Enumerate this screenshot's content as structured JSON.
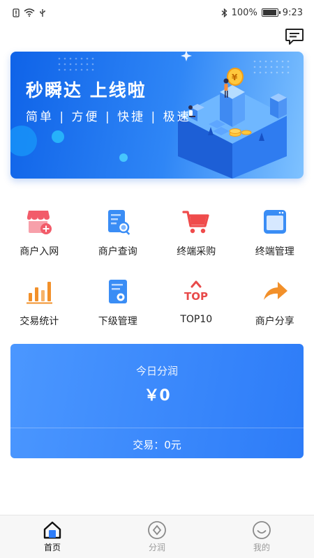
{
  "status_bar": {
    "battery": "100%",
    "time": "9:23"
  },
  "header": {
    "message_icon": "message-icon"
  },
  "banner": {
    "title": "秒瞬达  上线啦",
    "subtitle": "简单 | 方便 | 快捷 | 极速"
  },
  "menu": {
    "items": [
      {
        "label": "商户入网",
        "icon": "store-add-icon",
        "color": "#f25c6a"
      },
      {
        "label": "商户查询",
        "icon": "document-search-icon",
        "color": "#3a8df5"
      },
      {
        "label": "终端采购",
        "icon": "cart-icon",
        "color": "#ef4b4b"
      },
      {
        "label": "终端管理",
        "icon": "window-icon",
        "color": "#3a8df5"
      },
      {
        "label": "交易统计",
        "icon": "bar-chart-icon",
        "color": "#f2902a"
      },
      {
        "label": "下级管理",
        "icon": "document-settings-icon",
        "color": "#3a8df5"
      },
      {
        "label": "TOP10",
        "icon": "top-icon",
        "color": "#e84a4a"
      },
      {
        "label": "商户分享",
        "icon": "share-arrow-icon",
        "color": "#f2902a"
      }
    ]
  },
  "profit_card": {
    "title": "今日分润",
    "amount": "￥0",
    "trade": "交易：0元"
  },
  "bottom_nav": {
    "items": [
      {
        "label": "首页",
        "icon": "home-icon",
        "active": true
      },
      {
        "label": "分润",
        "icon": "diamond-icon",
        "active": false
      },
      {
        "label": "我的",
        "icon": "smiley-icon",
        "active": false
      }
    ]
  },
  "colors": {
    "primary": "#2d7cf8",
    "banner_dark": "#0f63e8",
    "nav_bg": "#f7f7f7"
  }
}
